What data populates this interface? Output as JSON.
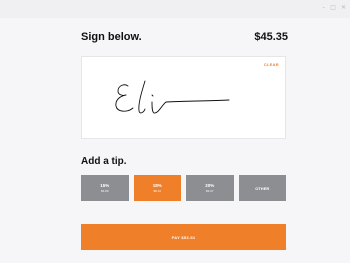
{
  "window": {
    "controls": [
      "–",
      "□",
      "✕"
    ]
  },
  "header": {
    "title": "Sign below.",
    "amount": "$45.35"
  },
  "signature_pad": {
    "clear_label": "CLEAR"
  },
  "tip": {
    "title": "Add a tip.",
    "options": [
      {
        "percent": "15%",
        "value": "$6.80",
        "selected": false
      },
      {
        "percent": "18%",
        "value": "$8.16",
        "selected": true
      },
      {
        "percent": "20%",
        "value": "$9.07",
        "selected": false
      }
    ],
    "other_label": "OTHER"
  },
  "pay_button": {
    "label": "PAY $53.51"
  },
  "colors": {
    "accent": "#f07f2a",
    "tip_default": "#8d8e91",
    "background": "#f6f6f8"
  }
}
